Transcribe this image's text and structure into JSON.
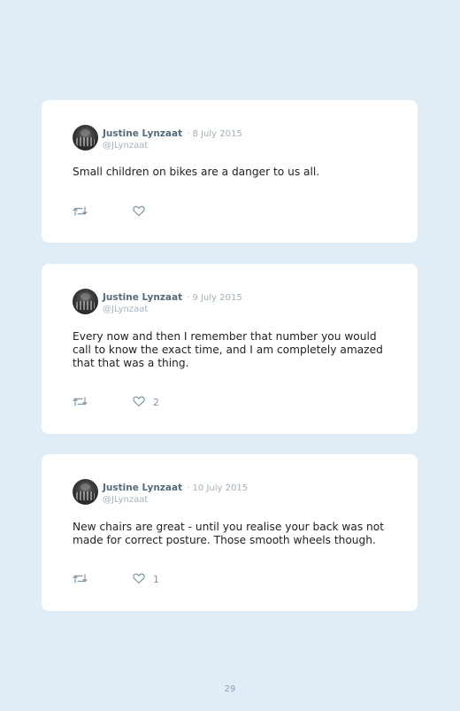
{
  "tweets": [
    {
      "author": "Justine Lynzaat",
      "date": "· 8 July 2015",
      "handle": "@JLynzaat",
      "text": "Small children on bikes are a danger to us all.",
      "likes": ""
    },
    {
      "author": "Justine Lynzaat",
      "date": "· 9 July 2015",
      "handle": "@JLynzaat",
      "text": "Every now and then I remember that number you would call to know the exact time, and I am completely amazed that that was a thing.",
      "likes": "2"
    },
    {
      "author": "Justine Lynzaat",
      "date": "· 10 July 2015",
      "handle": "@JLynzaat",
      "text": "New chairs are great - until you realise your back was not made for correct posture. Those smooth wheels though.",
      "likes": "1"
    }
  ],
  "page_number": "29"
}
